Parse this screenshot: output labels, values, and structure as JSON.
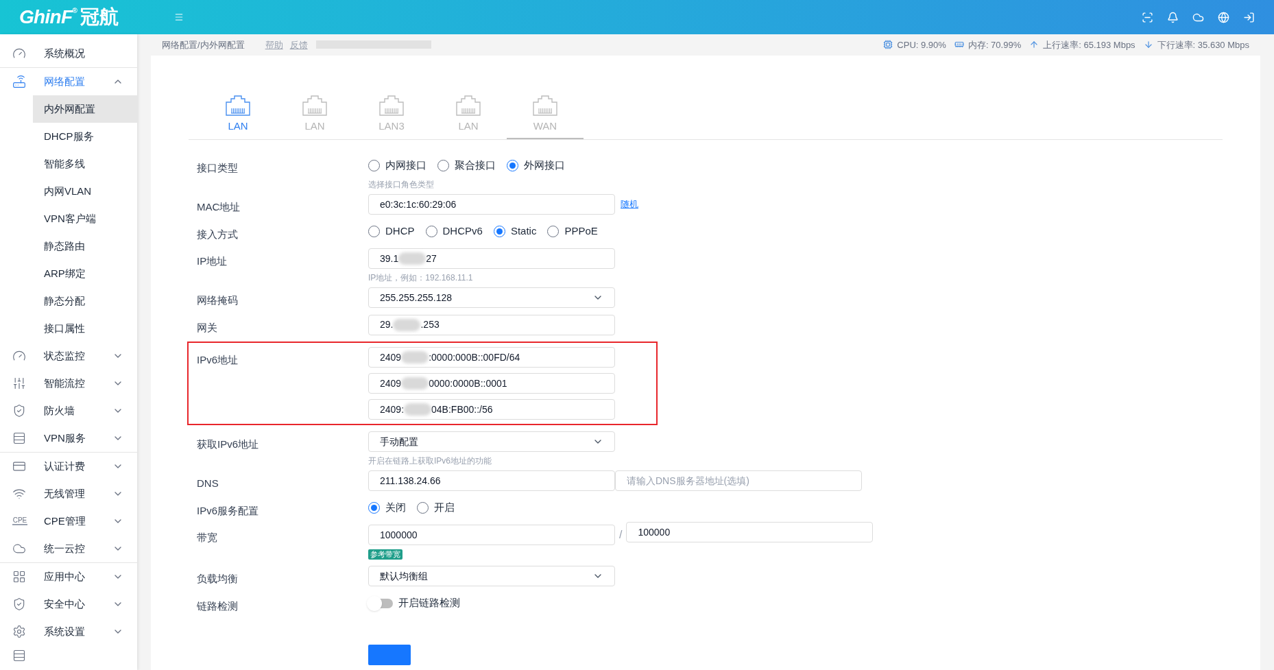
{
  "header": {
    "logo_text": "GhinF",
    "logo_mark": "®",
    "logo_cn": "冠航"
  },
  "breadcrumb": {
    "path": "网络配置/内外网配置",
    "links": [
      "帮助",
      "反馈"
    ]
  },
  "stats": [
    {
      "kind": "cpu",
      "text": "CPU: 9.90%"
    },
    {
      "kind": "memory",
      "text": "内存: 70.99%"
    },
    {
      "kind": "up",
      "text": "上行速率: 65.193 Mbps"
    },
    {
      "kind": "down",
      "text": "下行速率: 35.630 Mbps"
    }
  ],
  "sidebar": {
    "items": [
      {
        "label": "系统概况"
      },
      {
        "label": "网络配置",
        "expanded": true,
        "children": [
          {
            "label": "内外网配置",
            "selected": true
          },
          {
            "label": "DHCP服务",
            "selected": false
          },
          {
            "label": "智能多线",
            "selected": false
          },
          {
            "label": "内网VLAN",
            "selected": false
          },
          {
            "label": "VPN客户端",
            "selected": false
          },
          {
            "label": "静态路由",
            "selected": false
          },
          {
            "label": "ARP绑定",
            "selected": false
          },
          {
            "label": "静态分配",
            "selected": false
          },
          {
            "label": "接口属性",
            "selected": false
          }
        ]
      },
      {
        "label": "状态监控",
        "expanded": false
      },
      {
        "label": "智能流控",
        "expanded": false
      },
      {
        "label": "防火墙",
        "expanded": false
      },
      {
        "label": "VPN服务",
        "expanded": false
      },
      {
        "label": "认证计费",
        "expanded": false
      },
      {
        "label": "无线管理",
        "expanded": false
      },
      {
        "label": "CPE管理",
        "icon_text": "CPE",
        "expanded": false
      },
      {
        "label": "统一云控",
        "expanded": false
      },
      {
        "label": "应用中心",
        "expanded": false
      },
      {
        "label": "安全中心",
        "expanded": false
      },
      {
        "label": "系统设置",
        "expanded": false
      }
    ]
  },
  "tabs": [
    {
      "label": "LAN",
      "connected": true,
      "selected": false
    },
    {
      "label": "LAN",
      "connected": false,
      "selected": false
    },
    {
      "label": "LAN3",
      "connected": false,
      "selected": false
    },
    {
      "label": "LAN",
      "connected": false,
      "selected": false
    },
    {
      "label": "WAN",
      "connected": false,
      "selected": true
    }
  ],
  "form": [
    {
      "kind": "radio",
      "label": "接口类型",
      "options": [
        {
          "label": "内网接口",
          "selected": false
        },
        {
          "label": "聚合接口",
          "selected": false
        },
        {
          "label": "外网接口",
          "selected": true
        }
      ],
      "hint": "选择接口角色类型"
    },
    {
      "kind": "input",
      "label": "MAC地址",
      "value": "e0:3c:1c:60:29:06",
      "link": "随机"
    },
    {
      "kind": "radio",
      "label": "接入方式",
      "options": [
        {
          "label": "DHCP",
          "selected": false
        },
        {
          "label": "DHCPv6",
          "selected": false
        },
        {
          "label": "Static",
          "selected": true
        },
        {
          "label": "PPPoE",
          "selected": false
        }
      ]
    },
    {
      "kind": "redacted",
      "label": "IP地址",
      "values": [
        {
          "before": "39.1",
          "after": "27"
        }
      ],
      "hint": "IP地址，例如：192.168.11.1"
    },
    {
      "kind": "select",
      "label": "网络掩码",
      "value": "255.255.255.128"
    },
    {
      "kind": "redacted",
      "label": "网关",
      "values": [
        {
          "before": "29.",
          "after": ".253"
        }
      ]
    },
    {
      "kind": "redacted",
      "label": "IPv6地址",
      "highlighted": true,
      "values": [
        {
          "before": "2409",
          "after": ":0000:000B::00FD/64"
        },
        {
          "before": "2409",
          "after": "0000:0000B::0001"
        },
        {
          "before": "2409:",
          "after": "04B:FB00::/56"
        }
      ]
    },
    {
      "kind": "select",
      "label": "获取IPv6地址",
      "value": "手动配置",
      "hint": "开启在链路上获取IPv6地址的功能"
    },
    {
      "kind": "pair",
      "label": "DNS",
      "value": "211.138.24.66",
      "placeholder": "请输入DNS服务器地址(选填)"
    },
    {
      "kind": "radio",
      "label": "IPv6服务配置",
      "options": [
        {
          "label": "关闭",
          "selected": true
        },
        {
          "label": "开启",
          "selected": false
        }
      ]
    },
    {
      "kind": "pair",
      "label": "带宽",
      "value": "1000000",
      "separator": "/",
      "value2": "100000",
      "badge": "参考带宽"
    },
    {
      "kind": "select",
      "label": "负载均衡",
      "value": "默认均衡组"
    },
    {
      "kind": "toggle",
      "label": "链路检测",
      "on": false,
      "text": "开启链路检测"
    }
  ]
}
